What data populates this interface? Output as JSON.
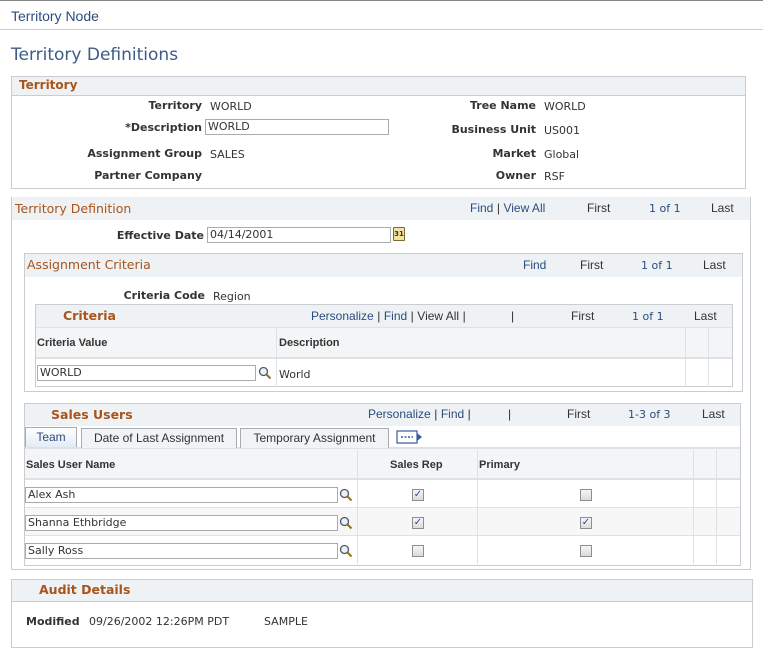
{
  "header": {
    "node_title": "Territory Node",
    "page_title": "Territory Definitions"
  },
  "territory": {
    "section_title": "Territory",
    "left": [
      {
        "label": "Territory",
        "value": "WORLD"
      },
      {
        "label": "*Description",
        "value": "WORLD"
      },
      {
        "label": "Assignment Group",
        "value": "SALES"
      },
      {
        "label": "Partner Company",
        "value": ""
      }
    ],
    "right": [
      {
        "label": "Tree Name",
        "value": "WORLD"
      },
      {
        "label": "Business Unit",
        "value": "US001"
      },
      {
        "label": "Market",
        "value": "Global"
      },
      {
        "label": "Owner",
        "value": "RSF"
      }
    ]
  },
  "territory_definition": {
    "section_title": "Territory Definition",
    "nav": {
      "find": "Find",
      "sep": "|",
      "view_all": "View All",
      "first": "First",
      "count": "1 of 1",
      "last": "Last"
    },
    "effective_date_label": "Effective Date",
    "effective_date": "04/14/2001",
    "calendar_icon_text": "31"
  },
  "assignment_criteria": {
    "section_title": "Assignment Criteria",
    "nav": {
      "find": "Find",
      "first": "First",
      "count": "1 of 1",
      "last": "Last"
    },
    "criteria_code_label": "Criteria Code",
    "criteria_code": "Region",
    "criteria_grid": {
      "title": "Criteria",
      "nav": {
        "personalize": "Personalize",
        "find": "Find",
        "view_all": "View All",
        "sep": "|",
        "first": "First",
        "count": "1 of 1",
        "last": "Last"
      },
      "columns": [
        "Criteria Value",
        "Description"
      ],
      "rows": [
        {
          "value": "WORLD",
          "description": "World"
        }
      ]
    }
  },
  "sales_users": {
    "title": "Sales Users",
    "nav": {
      "personalize": "Personalize",
      "find": "Find",
      "sep": "|",
      "first": "First",
      "count": "1-3 of 3",
      "last": "Last"
    },
    "tabs": [
      {
        "label": "Team",
        "active": true
      },
      {
        "label": "Date of Last Assignment",
        "active": false
      },
      {
        "label": "Temporary Assignment",
        "active": false
      }
    ],
    "columns": [
      "Sales User Name",
      "Sales Rep",
      "Primary"
    ],
    "rows": [
      {
        "name": "Alex Ash",
        "sales_rep": true,
        "primary": false
      },
      {
        "name": "Shanna Ethbridge",
        "sales_rep": true,
        "primary": true
      },
      {
        "name": "Sally Ross",
        "sales_rep": false,
        "primary": false
      }
    ]
  },
  "audit": {
    "title": "Audit Details",
    "modified_label": "Modified",
    "modified_datetime": "09/26/2002 12:26PM PDT",
    "modified_by": "SAMPLE"
  },
  "check_glyph": "✓"
}
